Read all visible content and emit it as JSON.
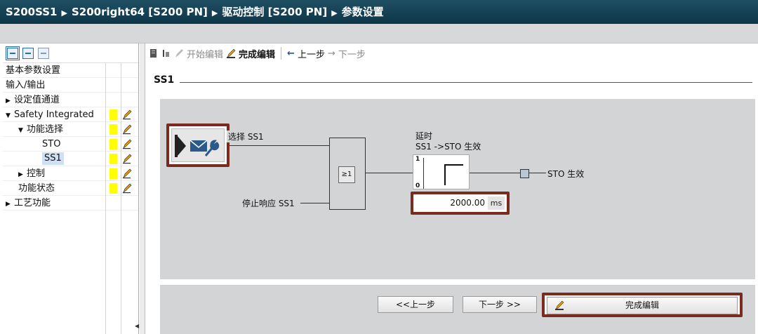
{
  "breadcrumb": [
    "S200SS1",
    "S200right64 [S200 PN]",
    "驱动控制 [S200 PN]",
    "参数设置"
  ],
  "tree": {
    "items": [
      {
        "label": "基本参数设置",
        "indent": 0,
        "expander": "",
        "marks": false
      },
      {
        "label": "输入/输出",
        "indent": 0,
        "expander": "",
        "marks": false
      },
      {
        "label": "设定值通道",
        "indent": 0,
        "expander": "▶",
        "marks": false
      },
      {
        "label": "Safety Integrated",
        "indent": 0,
        "expander": "▼",
        "marks": true
      },
      {
        "label": "功能选择",
        "indent": 1,
        "expander": "▼",
        "marks": true
      },
      {
        "label": "STO",
        "indent": 2,
        "expander": "",
        "marks": true
      },
      {
        "label": "SS1",
        "indent": 2,
        "expander": "",
        "marks": true,
        "selected": true
      },
      {
        "label": "控制",
        "indent": 1,
        "expander": "▶",
        "marks": true
      },
      {
        "label": "功能状态",
        "indent": 1,
        "expander": "",
        "marks": true
      },
      {
        "label": "工艺功能",
        "indent": 0,
        "expander": "▶",
        "marks": false
      }
    ]
  },
  "toolbar": {
    "start_edit": "开始编辑",
    "finish_edit": "完成编辑",
    "prev": "上一步",
    "next": "下一步",
    "arrow_prev": "←",
    "arrow_next": "→"
  },
  "section_title": "SS1",
  "diagram": {
    "select_label": "选择 SS1",
    "stop_label": "停止响应 SS1",
    "or_label": "≥1",
    "delay_title": "延时",
    "delay_sub": "SS1 ->STO 生效",
    "timer_high": "1",
    "timer_low": "0",
    "delay_value": "2000.00",
    "delay_unit": "ms",
    "output_label": "STO 生效"
  },
  "footer": {
    "prev_button": "<<上一步",
    "next_button": "下一步 >>",
    "finish_button": "完成编辑"
  },
  "colors": {
    "highlight_border": "#7b2a1e",
    "title_bar": "#0e3548",
    "panel_gray": "#d3d4d6",
    "marker_yellow": "#ffff00"
  }
}
